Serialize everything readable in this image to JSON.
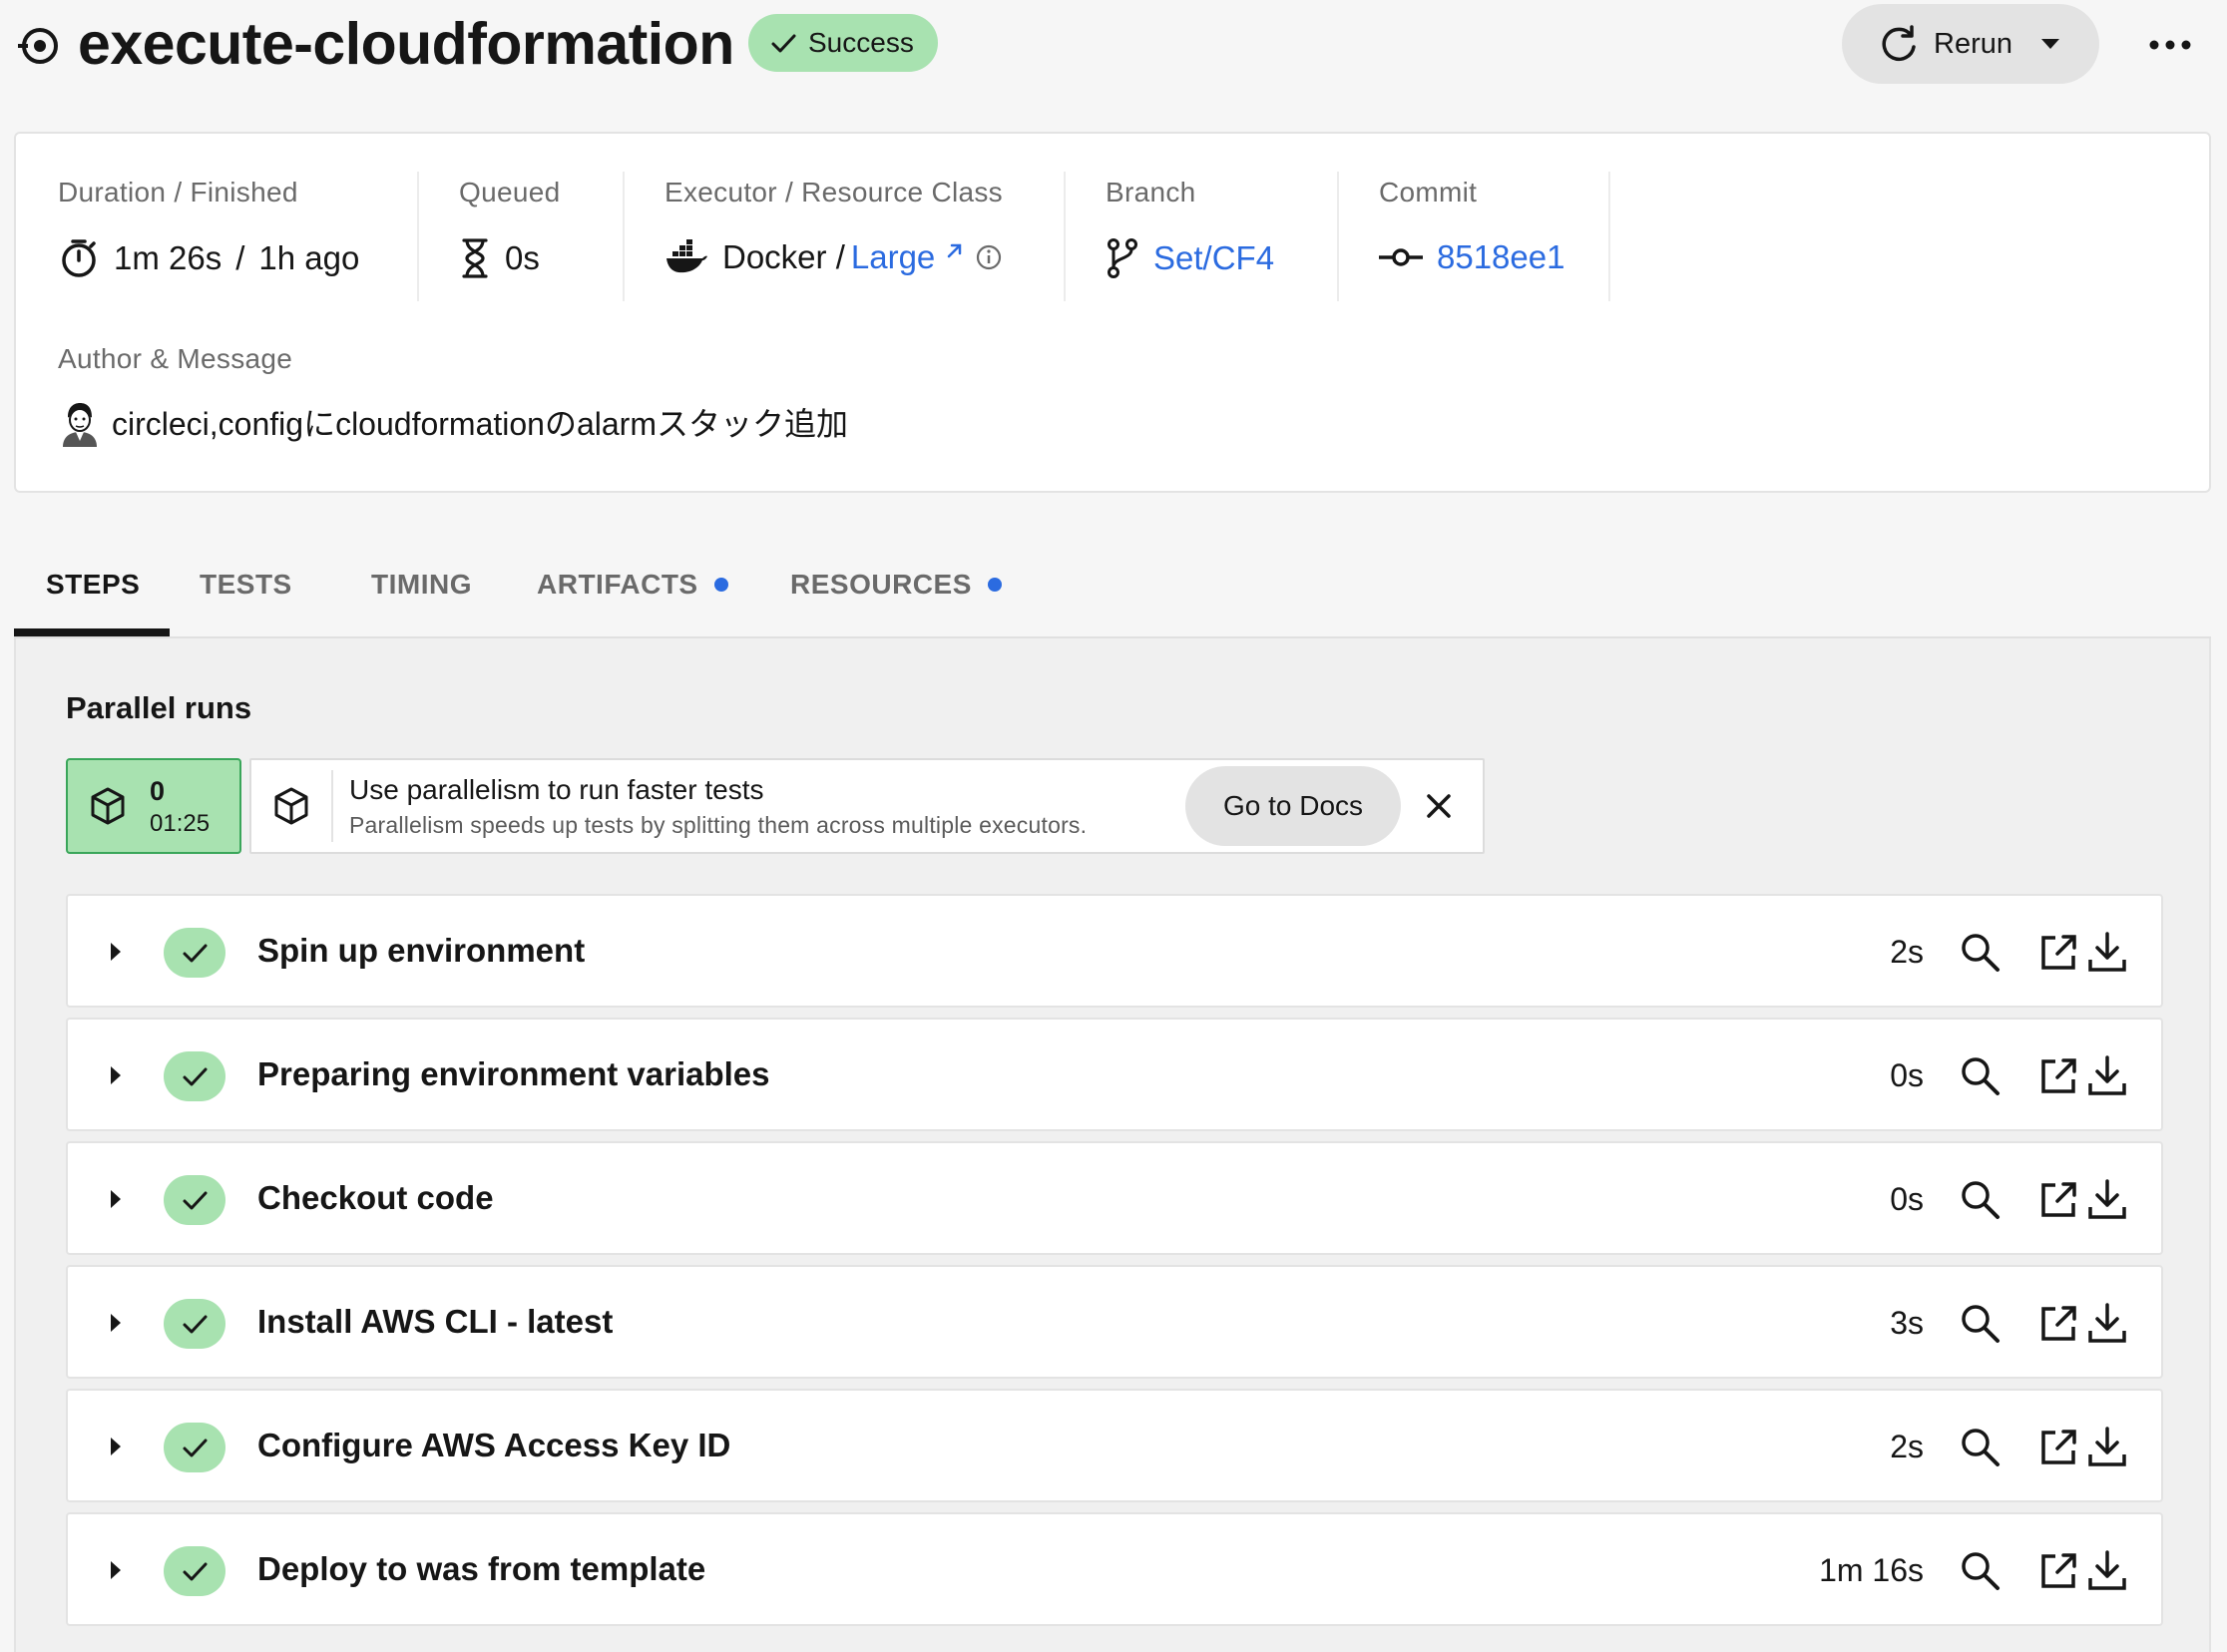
{
  "header": {
    "job_title": "execute-cloudformation",
    "status": "Success",
    "rerun_label": "Rerun"
  },
  "details": {
    "duration": {
      "label": "Duration / Finished",
      "duration": "1m 26s",
      "separator": "/",
      "finished": "1h ago"
    },
    "queued": {
      "label": "Queued",
      "value": "0s"
    },
    "executor": {
      "label": "Executor / Resource Class",
      "executor": "Docker /",
      "resource_class": "Large"
    },
    "branch": {
      "label": "Branch",
      "value": "Set/CF4"
    },
    "commit": {
      "label": "Commit",
      "value": "8518ee1"
    },
    "author": {
      "label": "Author & Message",
      "message": "circleci,configにcloudformationのalarmスタック追加"
    }
  },
  "tabs": [
    {
      "label": "STEPS",
      "active": true,
      "indicator": false
    },
    {
      "label": "TESTS",
      "active": false,
      "indicator": false
    },
    {
      "label": "TIMING",
      "active": false,
      "indicator": false
    },
    {
      "label": "ARTIFACTS",
      "active": false,
      "indicator": true
    },
    {
      "label": "RESOURCES",
      "active": false,
      "indicator": true
    }
  ],
  "parallel": {
    "title": "Parallel runs",
    "run": {
      "index": "0",
      "time": "01:25"
    },
    "banner": {
      "title": "Use parallelism to run faster tests",
      "subtitle": "Parallelism speeds up tests by splitting them across multiple executors.",
      "button": "Go to Docs"
    }
  },
  "steps": [
    {
      "name": "Spin up environment",
      "duration": "2s"
    },
    {
      "name": "Preparing environment variables",
      "duration": "0s"
    },
    {
      "name": "Checkout code",
      "duration": "0s"
    },
    {
      "name": "Install AWS CLI - latest",
      "duration": "3s"
    },
    {
      "name": "Configure AWS Access Key ID",
      "duration": "2s"
    },
    {
      "name": "Deploy to was from template",
      "duration": "1m 16s"
    }
  ],
  "colors": {
    "success_bg": "#a8e2b0",
    "success_border": "#3aa65a",
    "link": "#2b6be0",
    "text": "#161616",
    "muted": "#6a6a6a"
  },
  "icons": [
    "job-icon",
    "check-icon",
    "rerun-icon",
    "caret-down-icon",
    "more-icon",
    "stopwatch-icon",
    "hourglass-icon",
    "docker-icon",
    "external-link-icon",
    "info-icon",
    "branch-icon",
    "commit-icon",
    "avatar",
    "box-icon",
    "close-icon",
    "expand-triangle-icon",
    "search-icon",
    "download-icon"
  ]
}
